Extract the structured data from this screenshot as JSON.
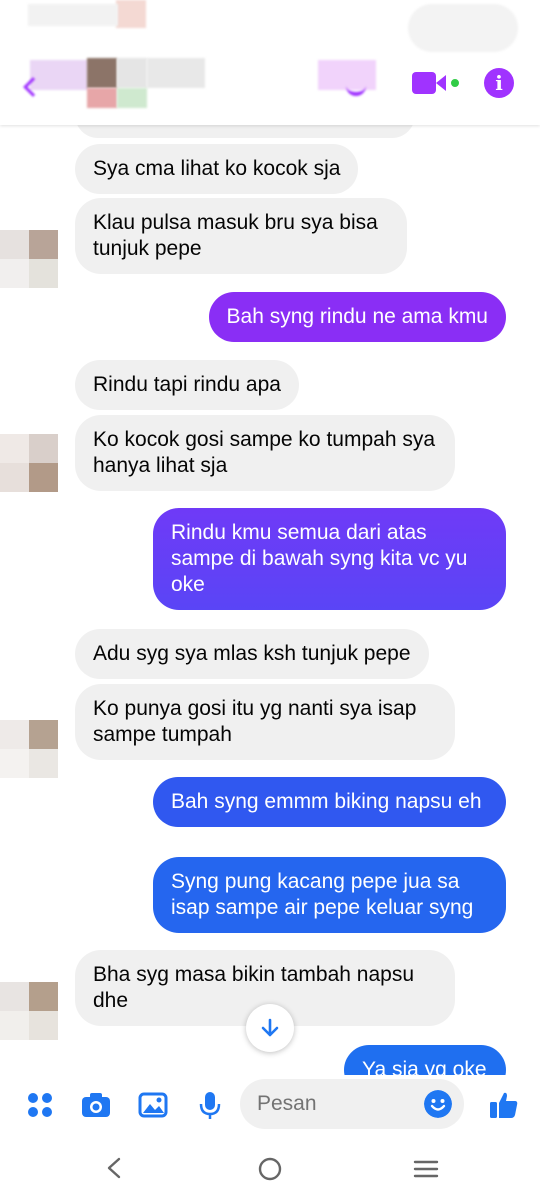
{
  "header": {
    "contact_name": "",
    "colors": {
      "accent": "#a033ff",
      "online": "#31cc46"
    },
    "icons": [
      "back-arrow-icon",
      "phone-icon",
      "video-camera-icon",
      "info-icon"
    ]
  },
  "messages": [
    {
      "side": "in",
      "text": "Sya cma lihat ko kocok sja",
      "color": "#f0f0f0"
    },
    {
      "side": "in",
      "text": "Klau pulsa masuk bru sya bisa tunjuk pepe",
      "color": "#f0f0f0"
    },
    {
      "side": "out",
      "text": "Bah syng rindu ne ama kmu",
      "color": "#8a2ef5"
    },
    {
      "side": "in",
      "text": "Rindu tapi rindu apa",
      "color": "#f0f0f0"
    },
    {
      "side": "in",
      "text": "Ko kocok gosi sampe ko tumpah sya hanya lihat sja",
      "color": "#f0f0f0"
    },
    {
      "side": "out",
      "text": "Rindu kmu semua dari atas sampe di bawah syng kita vc yu oke",
      "color": "#6a40f7"
    },
    {
      "side": "in",
      "text": "Adu syg sya mlas ksh tunjuk pepe",
      "color": "#f0f0f0"
    },
    {
      "side": "in",
      "text": "Ko punya gosi itu yg nanti sya isap sampe tumpah",
      "color": "#f0f0f0"
    },
    {
      "side": "out",
      "text": "Bah syng emmm biking napsu eh",
      "color": "#2f5cf0"
    },
    {
      "side": "out",
      "text": "Syng pung kacang pepe jua sa isap sampe air pepe keluar syng",
      "color": "#2566ef"
    },
    {
      "side": "in",
      "text": "Bha syg masa bikin tambah napsu dhe",
      "color": "#f0f0f0"
    },
    {
      "side": "out",
      "text": "Ya sja yg oke",
      "color": "#1f6ff0"
    }
  ],
  "composer": {
    "placeholder": "Pesan",
    "icons": [
      "menu-dots-icon",
      "camera-icon",
      "gallery-icon",
      "microphone-icon",
      "emoji-icon",
      "like-icon"
    ],
    "accent": "#1f77f2"
  },
  "scroll_button": {
    "icon": "arrow-down-icon"
  },
  "system_nav": {
    "icons": [
      "back-icon",
      "home-icon",
      "recents-icon"
    ]
  }
}
